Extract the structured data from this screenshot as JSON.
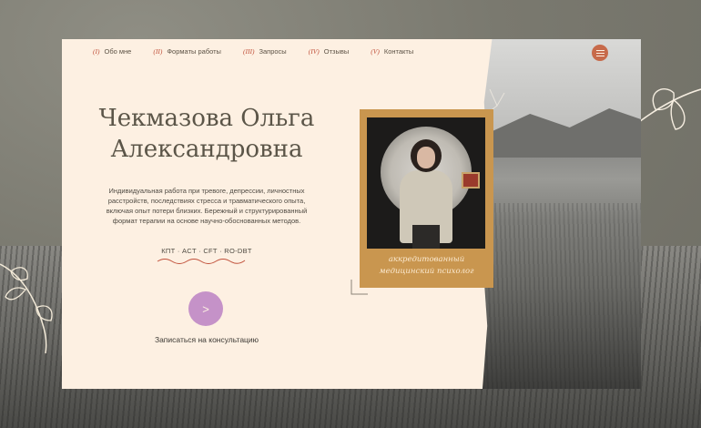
{
  "nav": {
    "items": [
      {
        "num": "(I)",
        "label": "Обо мне"
      },
      {
        "num": "(II)",
        "label": "Форматы работы"
      },
      {
        "num": "(III)",
        "label": "Запросы"
      },
      {
        "num": "(IV)",
        "label": "Отзывы"
      },
      {
        "num": "(V)",
        "label": "Контакты"
      }
    ],
    "menu_icon": "hamburger-icon"
  },
  "hero": {
    "name_line1": "Чекмазова Ольга",
    "name_line2": "Александровна",
    "description": "Индивидуальная работа при тревоге, депрессии, личностных расстройств, последствиях стресса и травматического опыта, включая опыт потери близких. Бережный и структурированный формат терапии на основе научно-обоснованных методов.",
    "methods": "КПТ · ACT · CFT · RO-DBT",
    "cta_arrow": ">",
    "cta_label": "Записаться на консультацию"
  },
  "portrait": {
    "caption_line1": "аккредитованный",
    "caption_line2": "медицинский психолог"
  },
  "colors": {
    "card": "#fdf0e2",
    "accent": "#c76a4a",
    "cta": "#c592c8",
    "frame": "#c9964f"
  }
}
